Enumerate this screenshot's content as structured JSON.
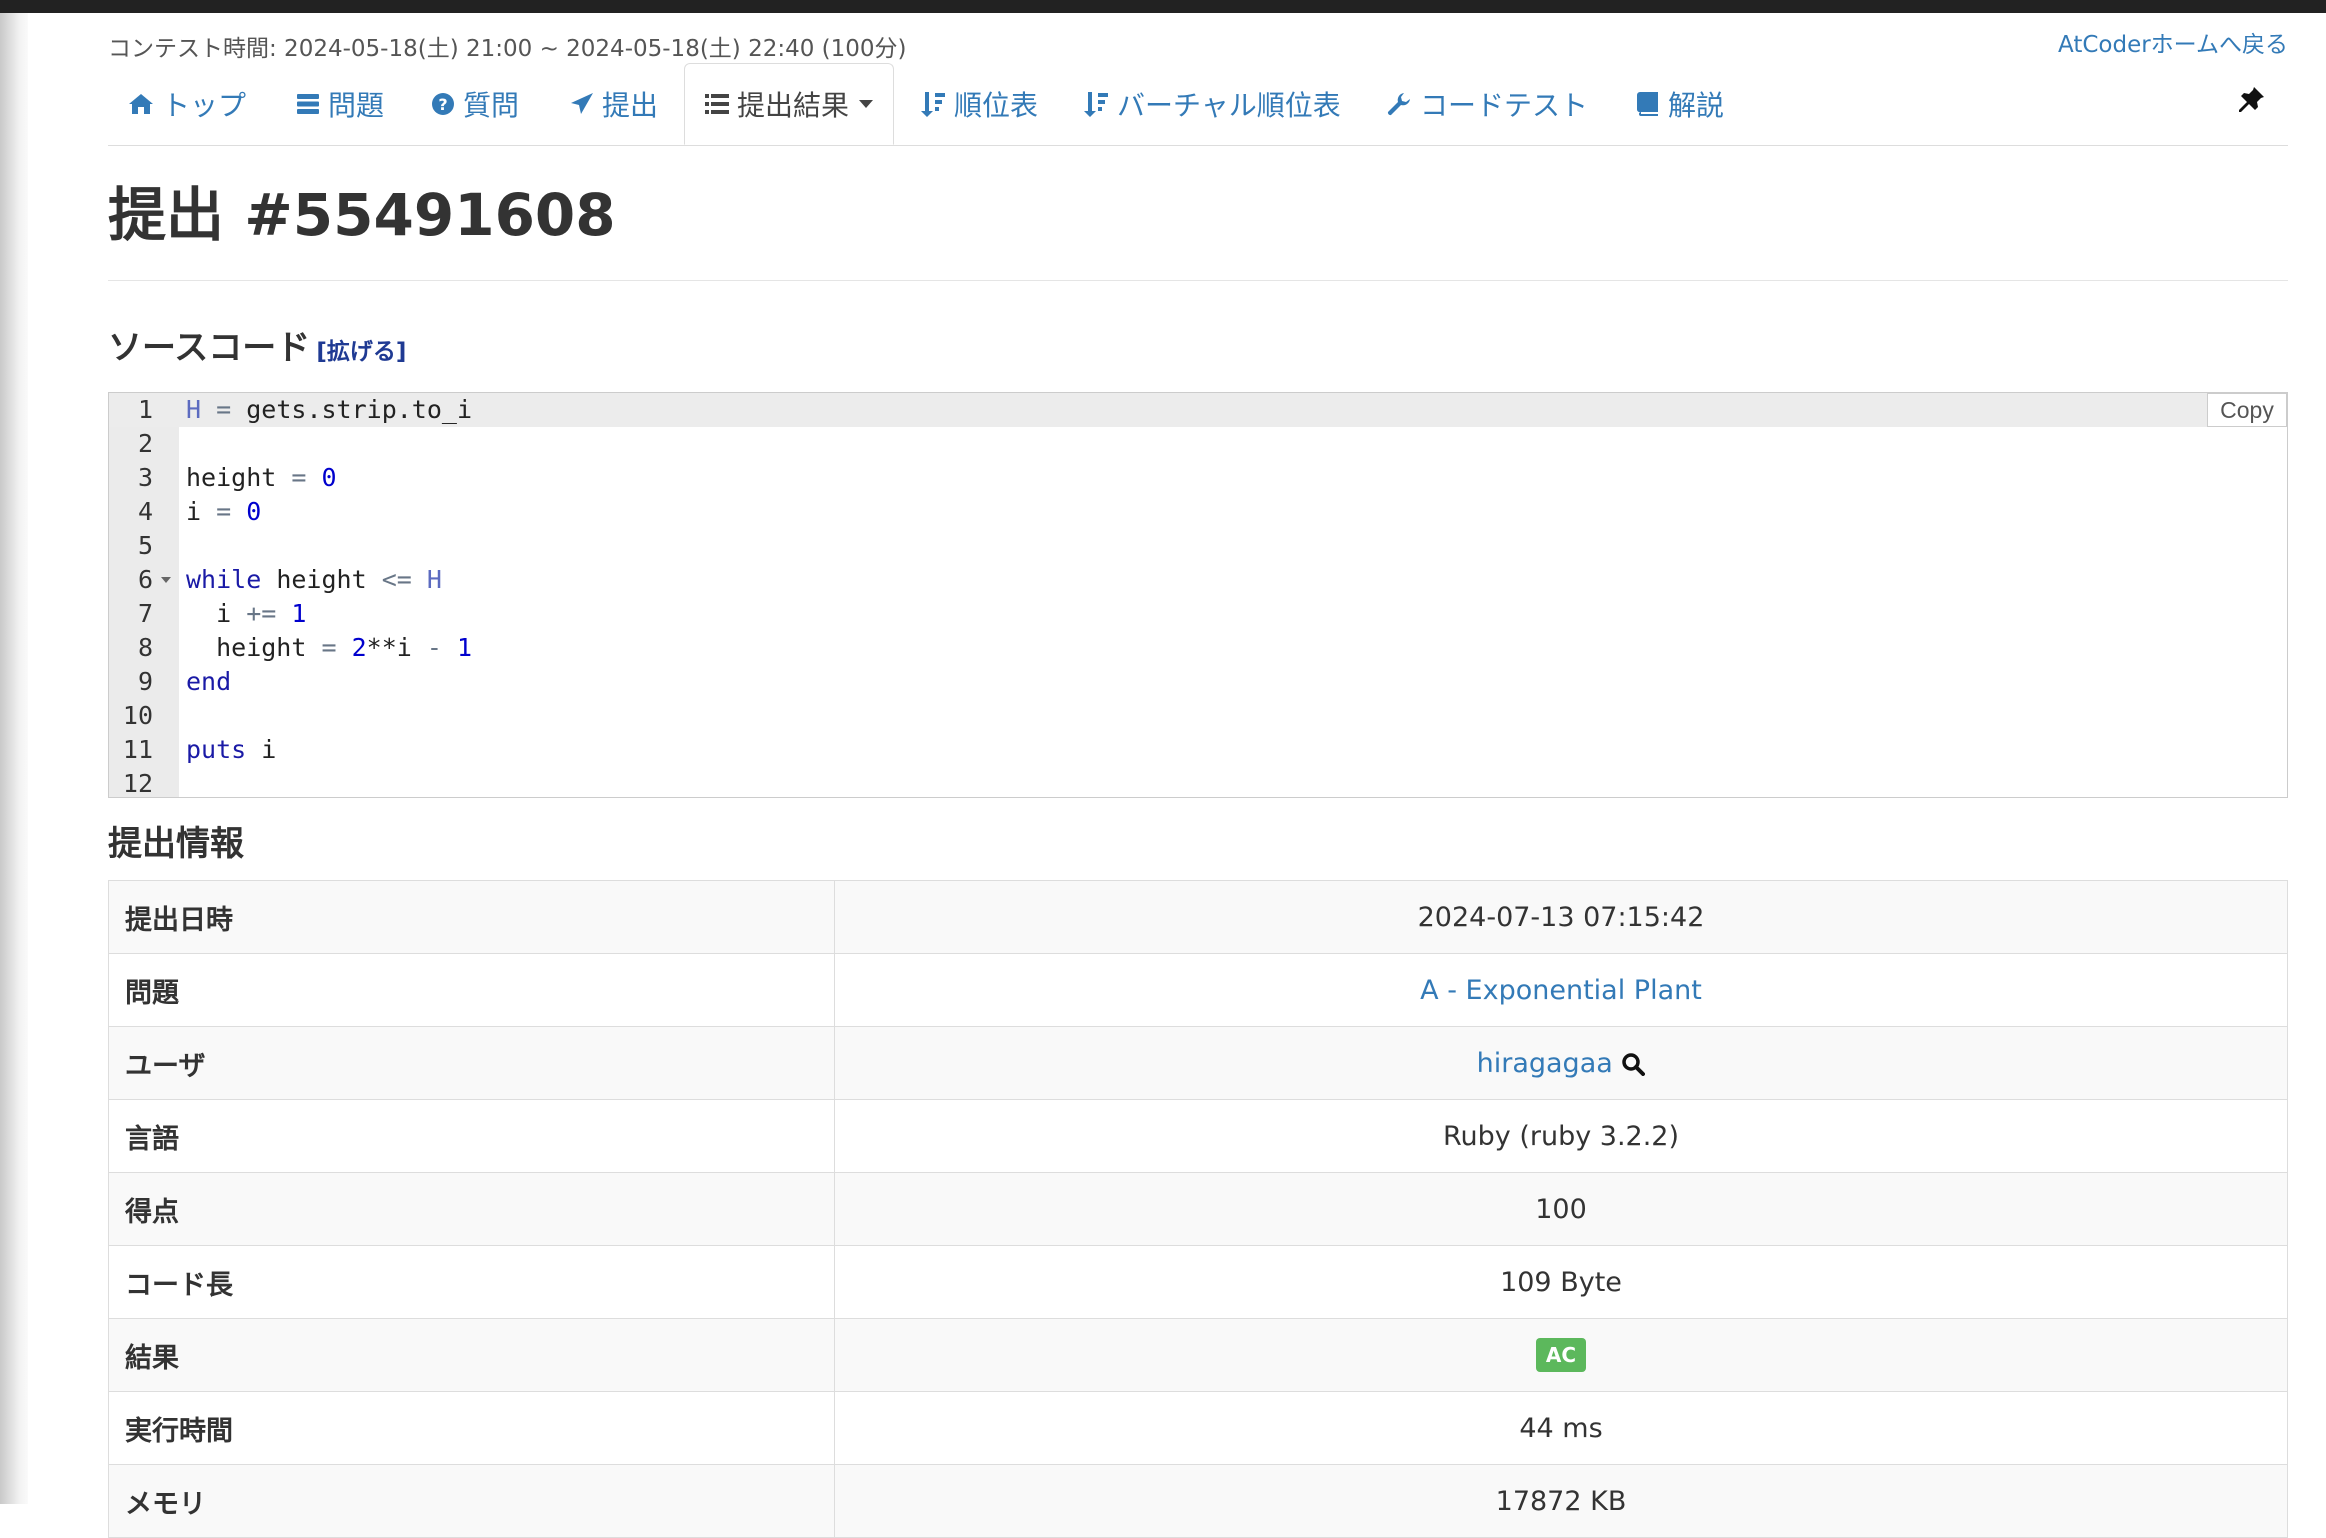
{
  "header": {
    "contest_time": "コンテスト時間: 2024-05-18(土) 21:00 ~ 2024-05-18(土) 22:40 (100分)",
    "home_link": "AtCoderホームへ戻る"
  },
  "nav": {
    "items": [
      {
        "label": "トップ",
        "icon": "home-icon"
      },
      {
        "label": "問題",
        "icon": "tasks-icon"
      },
      {
        "label": "質問",
        "icon": "question-icon"
      },
      {
        "label": "提出",
        "icon": "send-icon"
      },
      {
        "label": "提出結果",
        "icon": "list-icon",
        "active": true
      },
      {
        "label": "順位表",
        "icon": "sort-icon"
      },
      {
        "label": "バーチャル順位表",
        "icon": "sort-icon"
      },
      {
        "label": "コードテスト",
        "icon": "wrench-icon"
      },
      {
        "label": "解説",
        "icon": "book-icon"
      }
    ],
    "pin_icon": "pin-icon"
  },
  "page": {
    "title": "提出 #55491608"
  },
  "source": {
    "heading": "ソースコード",
    "expand_label": "[拡げる]",
    "copy_label": "Copy",
    "lines": [
      {
        "n": "1",
        "text": "H = gets.strip.to_i"
      },
      {
        "n": "2",
        "text": ""
      },
      {
        "n": "3",
        "text": "height = 0"
      },
      {
        "n": "4",
        "text": "i = 0"
      },
      {
        "n": "5",
        "text": ""
      },
      {
        "n": "6",
        "text": "while height <= H"
      },
      {
        "n": "7",
        "text": "  i += 1"
      },
      {
        "n": "8",
        "text": "  height = 2**i - 1"
      },
      {
        "n": "9",
        "text": "end"
      },
      {
        "n": "10",
        "text": ""
      },
      {
        "n": "11",
        "text": "puts i"
      },
      {
        "n": "12",
        "text": ""
      }
    ]
  },
  "submission": {
    "heading": "提出情報",
    "rows": [
      {
        "key": "提出日時",
        "value": "2024-07-13 07:15:42"
      },
      {
        "key": "問題",
        "value": "A - Exponential Plant"
      },
      {
        "key": "ユーザ",
        "value": "hiragagaa"
      },
      {
        "key": "言語",
        "value": "Ruby (ruby 3.2.2)"
      },
      {
        "key": "得点",
        "value": "100"
      },
      {
        "key": "コード長",
        "value": "109 Byte"
      },
      {
        "key": "結果",
        "value": "AC"
      },
      {
        "key": "実行時間",
        "value": "44 ms"
      },
      {
        "key": "メモリ",
        "value": "17872 KB"
      }
    ]
  },
  "colors": {
    "link": "#337ab7",
    "ac_badge": "#5cb85c",
    "keyword": "#1a1aa6"
  }
}
